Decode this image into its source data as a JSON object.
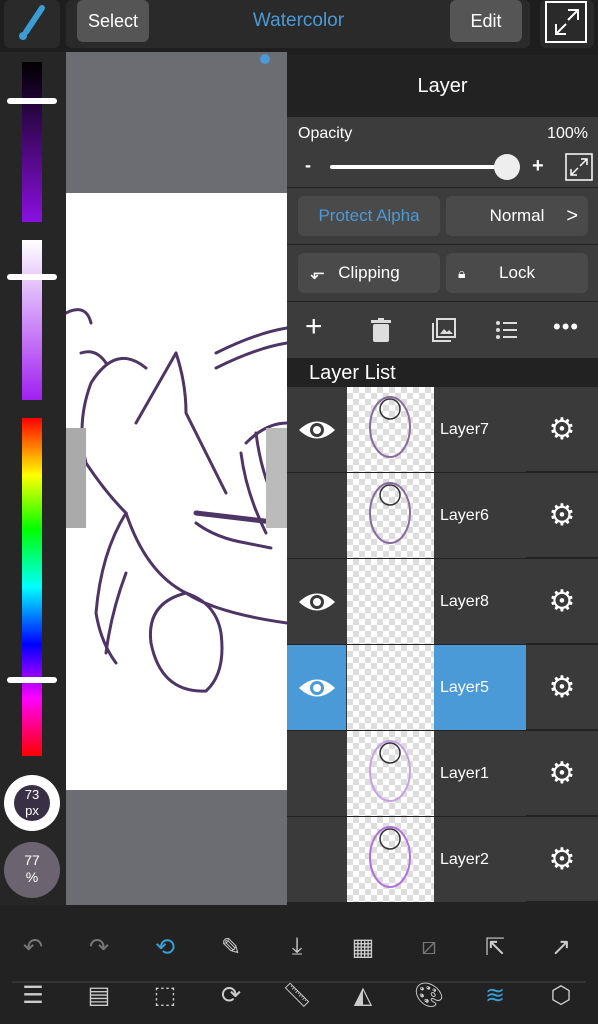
{
  "topbar": {
    "select_label": "Select",
    "brush_name": "Watercolor",
    "edit_label": "Edit"
  },
  "accent": "#4a9ad8",
  "left": {
    "brush_size": "73",
    "brush_size_unit": "px",
    "opacity": "77",
    "opacity_unit": "%"
  },
  "panel": {
    "title": "Layer",
    "opacity_label": "Opacity",
    "opacity_value": "100%",
    "opacity_fraction": 1.0,
    "minus": "-",
    "plus": "+",
    "protect_alpha": "Protect Alpha",
    "blend_mode": "Normal",
    "chevron": ">",
    "clipping": "Clipping",
    "lock": "Lock",
    "list_title": "Layer List",
    "layers": [
      {
        "name": "Layer7",
        "visible": true,
        "selected": false
      },
      {
        "name": "Layer6",
        "visible": false,
        "selected": false
      },
      {
        "name": "Layer8",
        "visible": true,
        "selected": false
      },
      {
        "name": "Layer5",
        "visible": true,
        "selected": true
      },
      {
        "name": "Layer1",
        "visible": false,
        "selected": false
      },
      {
        "name": "Layer2",
        "visible": false,
        "selected": false
      }
    ]
  },
  "toolbar_top": [
    "undo-icon",
    "redo-icon",
    "brush-swap-icon",
    "eyedropper-icon",
    "save-icon",
    "select-all-icon",
    "deselect-icon",
    "transform-icon",
    "share-icon"
  ],
  "toolbar_bottom": [
    "menu-icon",
    "pages-icon",
    "selection-icon",
    "rotate-icon",
    "ruler-icon",
    "fill-icon",
    "palette-icon",
    "layers-icon",
    "materials-icon"
  ]
}
